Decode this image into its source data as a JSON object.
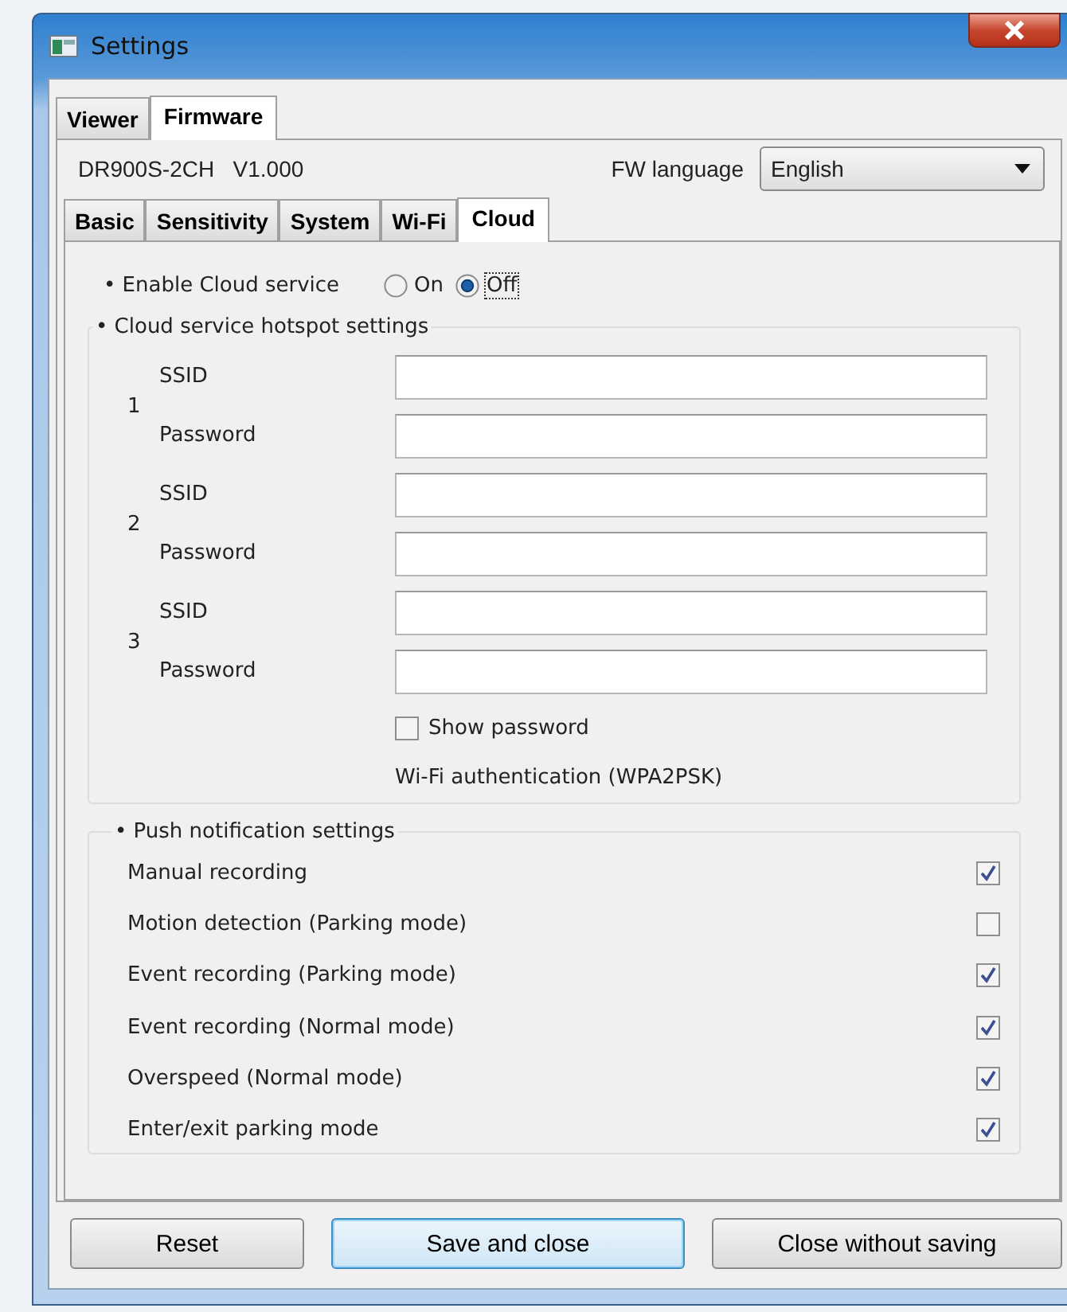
{
  "window": {
    "title": "Settings"
  },
  "top_tabs": [
    {
      "label": "Viewer",
      "selected": false
    },
    {
      "label": "Firmware",
      "selected": true
    }
  ],
  "device": {
    "model": "DR900S-2CH",
    "version": "V1.000",
    "language_label": "FW language",
    "language_value": "English"
  },
  "sub_tabs": [
    {
      "label": "Basic",
      "selected": false
    },
    {
      "label": "Sensitivity",
      "selected": false
    },
    {
      "label": "System",
      "selected": false
    },
    {
      "label": "Wi-Fi",
      "selected": false
    },
    {
      "label": "Cloud",
      "selected": true
    }
  ],
  "cloud_service": {
    "label": "• Enable Cloud service",
    "options": [
      {
        "label": "On",
        "selected": false
      },
      {
        "label": "Off",
        "selected": true
      }
    ]
  },
  "hotspot": {
    "title": "• Cloud service hotspot settings",
    "groups": [
      {
        "number": "1",
        "ssid_label": "SSID",
        "password_label": "Password"
      },
      {
        "number": "2",
        "ssid_label": "SSID",
        "password_label": "Password"
      },
      {
        "number": "3",
        "ssid_label": "SSID",
        "password_label": "Password"
      }
    ],
    "show_password": {
      "label": "Show password",
      "checked": false
    },
    "auth_note": "Wi-Fi authentication (WPA2PSK)"
  },
  "push": {
    "title": "• Push notification settings",
    "items": [
      {
        "label": "Manual recording",
        "checked": true
      },
      {
        "label": "Motion detection (Parking mode)",
        "checked": false
      },
      {
        "label": "Event recording (Parking mode)",
        "checked": true
      },
      {
        "label": "Event recording (Normal mode)",
        "checked": true
      },
      {
        "label": "Overspeed (Normal mode)",
        "checked": true
      },
      {
        "label": "Enter/exit parking mode",
        "checked": true
      }
    ]
  },
  "buttons": [
    {
      "label": "Reset",
      "default": false
    },
    {
      "label": "Save and close",
      "default": true
    },
    {
      "label": "Close without saving",
      "default": false
    }
  ]
}
